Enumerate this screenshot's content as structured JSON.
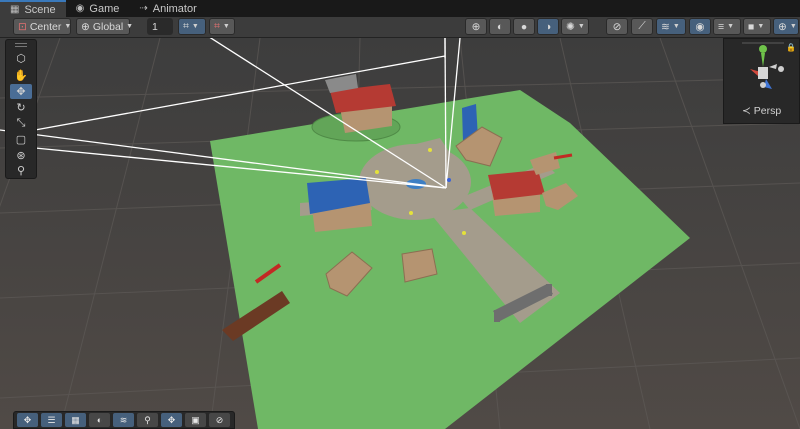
{
  "tabs": [
    {
      "label": "Scene",
      "icon": "grid-icon"
    },
    {
      "label": "Game",
      "icon": "gamepad-icon"
    },
    {
      "label": "Animator",
      "icon": "animator-icon"
    }
  ],
  "toolbar": {
    "pivot_label": "Center",
    "space_label": "Global",
    "grid_value": "1"
  },
  "gizmo": {
    "projection_label": "Persp"
  },
  "colors": {
    "accent": "#3a79bb",
    "ground": "#6fb865",
    "plaza": "#a49c8c",
    "roof_red": "#b53a33",
    "roof_blue": "#2d63b4",
    "building": "#b59471"
  }
}
